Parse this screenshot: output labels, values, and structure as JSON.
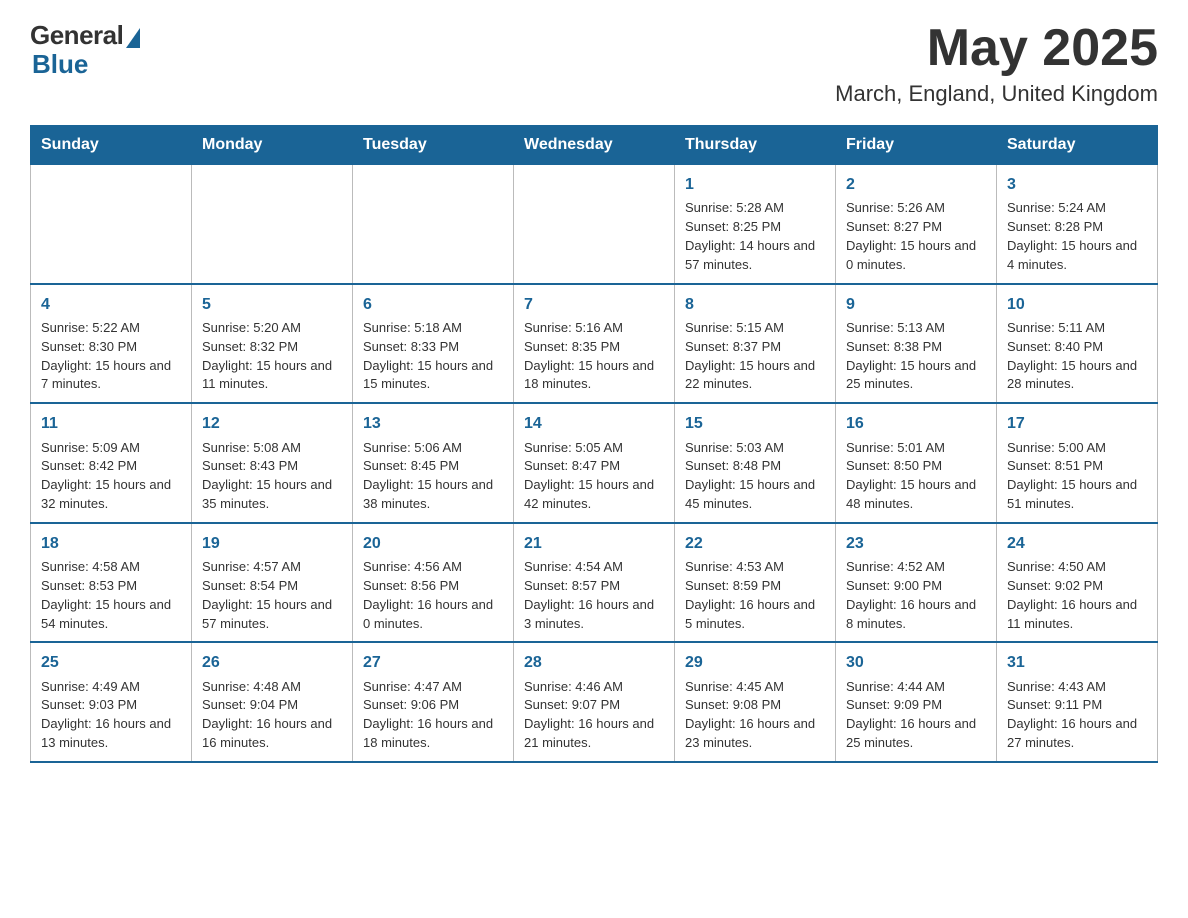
{
  "logo": {
    "general": "General",
    "blue": "Blue"
  },
  "title": {
    "month_year": "May 2025",
    "location": "March, England, United Kingdom"
  },
  "weekdays": [
    "Sunday",
    "Monday",
    "Tuesday",
    "Wednesday",
    "Thursday",
    "Friday",
    "Saturday"
  ],
  "weeks": [
    [
      {
        "day": "",
        "info": ""
      },
      {
        "day": "",
        "info": ""
      },
      {
        "day": "",
        "info": ""
      },
      {
        "day": "",
        "info": ""
      },
      {
        "day": "1",
        "info": "Sunrise: 5:28 AM\nSunset: 8:25 PM\nDaylight: 14 hours and 57 minutes."
      },
      {
        "day": "2",
        "info": "Sunrise: 5:26 AM\nSunset: 8:27 PM\nDaylight: 15 hours and 0 minutes."
      },
      {
        "day": "3",
        "info": "Sunrise: 5:24 AM\nSunset: 8:28 PM\nDaylight: 15 hours and 4 minutes."
      }
    ],
    [
      {
        "day": "4",
        "info": "Sunrise: 5:22 AM\nSunset: 8:30 PM\nDaylight: 15 hours and 7 minutes."
      },
      {
        "day": "5",
        "info": "Sunrise: 5:20 AM\nSunset: 8:32 PM\nDaylight: 15 hours and 11 minutes."
      },
      {
        "day": "6",
        "info": "Sunrise: 5:18 AM\nSunset: 8:33 PM\nDaylight: 15 hours and 15 minutes."
      },
      {
        "day": "7",
        "info": "Sunrise: 5:16 AM\nSunset: 8:35 PM\nDaylight: 15 hours and 18 minutes."
      },
      {
        "day": "8",
        "info": "Sunrise: 5:15 AM\nSunset: 8:37 PM\nDaylight: 15 hours and 22 minutes."
      },
      {
        "day": "9",
        "info": "Sunrise: 5:13 AM\nSunset: 8:38 PM\nDaylight: 15 hours and 25 minutes."
      },
      {
        "day": "10",
        "info": "Sunrise: 5:11 AM\nSunset: 8:40 PM\nDaylight: 15 hours and 28 minutes."
      }
    ],
    [
      {
        "day": "11",
        "info": "Sunrise: 5:09 AM\nSunset: 8:42 PM\nDaylight: 15 hours and 32 minutes."
      },
      {
        "day": "12",
        "info": "Sunrise: 5:08 AM\nSunset: 8:43 PM\nDaylight: 15 hours and 35 minutes."
      },
      {
        "day": "13",
        "info": "Sunrise: 5:06 AM\nSunset: 8:45 PM\nDaylight: 15 hours and 38 minutes."
      },
      {
        "day": "14",
        "info": "Sunrise: 5:05 AM\nSunset: 8:47 PM\nDaylight: 15 hours and 42 minutes."
      },
      {
        "day": "15",
        "info": "Sunrise: 5:03 AM\nSunset: 8:48 PM\nDaylight: 15 hours and 45 minutes."
      },
      {
        "day": "16",
        "info": "Sunrise: 5:01 AM\nSunset: 8:50 PM\nDaylight: 15 hours and 48 minutes."
      },
      {
        "day": "17",
        "info": "Sunrise: 5:00 AM\nSunset: 8:51 PM\nDaylight: 15 hours and 51 minutes."
      }
    ],
    [
      {
        "day": "18",
        "info": "Sunrise: 4:58 AM\nSunset: 8:53 PM\nDaylight: 15 hours and 54 minutes."
      },
      {
        "day": "19",
        "info": "Sunrise: 4:57 AM\nSunset: 8:54 PM\nDaylight: 15 hours and 57 minutes."
      },
      {
        "day": "20",
        "info": "Sunrise: 4:56 AM\nSunset: 8:56 PM\nDaylight: 16 hours and 0 minutes."
      },
      {
        "day": "21",
        "info": "Sunrise: 4:54 AM\nSunset: 8:57 PM\nDaylight: 16 hours and 3 minutes."
      },
      {
        "day": "22",
        "info": "Sunrise: 4:53 AM\nSunset: 8:59 PM\nDaylight: 16 hours and 5 minutes."
      },
      {
        "day": "23",
        "info": "Sunrise: 4:52 AM\nSunset: 9:00 PM\nDaylight: 16 hours and 8 minutes."
      },
      {
        "day": "24",
        "info": "Sunrise: 4:50 AM\nSunset: 9:02 PM\nDaylight: 16 hours and 11 minutes."
      }
    ],
    [
      {
        "day": "25",
        "info": "Sunrise: 4:49 AM\nSunset: 9:03 PM\nDaylight: 16 hours and 13 minutes."
      },
      {
        "day": "26",
        "info": "Sunrise: 4:48 AM\nSunset: 9:04 PM\nDaylight: 16 hours and 16 minutes."
      },
      {
        "day": "27",
        "info": "Sunrise: 4:47 AM\nSunset: 9:06 PM\nDaylight: 16 hours and 18 minutes."
      },
      {
        "day": "28",
        "info": "Sunrise: 4:46 AM\nSunset: 9:07 PM\nDaylight: 16 hours and 21 minutes."
      },
      {
        "day": "29",
        "info": "Sunrise: 4:45 AM\nSunset: 9:08 PM\nDaylight: 16 hours and 23 minutes."
      },
      {
        "day": "30",
        "info": "Sunrise: 4:44 AM\nSunset: 9:09 PM\nDaylight: 16 hours and 25 minutes."
      },
      {
        "day": "31",
        "info": "Sunrise: 4:43 AM\nSunset: 9:11 PM\nDaylight: 16 hours and 27 minutes."
      }
    ]
  ]
}
